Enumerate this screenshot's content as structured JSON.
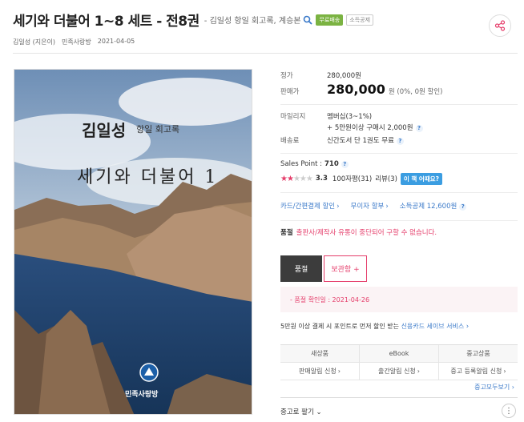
{
  "book": {
    "title": "세기와 더불어 1~8 세트 - 전8권",
    "subtitle": "- 김일성 항일 회고록, 계승본",
    "badge_free_shipping": "무료배송",
    "badge_income_deduction": "소득공제",
    "author": "김일성 (지은이)",
    "publisher": "민족사랑방",
    "pub_date": "2021-04-05"
  },
  "cover": {
    "author_text": "김일성",
    "subtitle_text": "항일 회고록",
    "title_text": "세기와 더불어 1",
    "publisher_logo_text": "민족사랑방"
  },
  "pricing": {
    "list_price_label": "정가",
    "list_price": "280,000원",
    "sale_price_label": "판매가",
    "sale_price": "280,000",
    "sale_price_unit_note": "원 (0%, 0원 할인)",
    "mileage_label": "마일리지",
    "mileage_value": "멤버십(3~1%)",
    "mileage_extra": "+ 5만원이상 구매시 2,000원",
    "shipping_label": "배송료",
    "shipping_value": "신간도서 단 1권도 무료"
  },
  "rating": {
    "sales_point_label": "Sales Point :",
    "sales_point_value": "710",
    "star_score": "3.3",
    "reviews_100": "100자평(31)",
    "reviews": "리뷰(3)",
    "ask_button": "이 책 어때요?"
  },
  "benefits": {
    "card_discount": "카드/간편결제 할인",
    "installment": "무이자 할부",
    "income_deduction": "소득공제 12,600원"
  },
  "status": {
    "soldout_label": "품절",
    "soldout_text": "출판사/제작사 유통이 중단되어 구할 수 없습니다.",
    "btn_soldout": "품절",
    "btn_wishlist": "보관함 +",
    "confirm_text": "- 품절 확인일 : 2021-04-26"
  },
  "promo": {
    "text": "5만원 이상 결제 시 포인트로 먼저 할인 받는",
    "link": "신용카드 세이브 서비스"
  },
  "table": {
    "headers": [
      "새상품",
      "eBook",
      "중고상품"
    ],
    "cells": [
      "판매알림 신청",
      "출간알림 신청",
      "중고 등록알림 신청"
    ]
  },
  "more_used_link": "중고모두보기",
  "used_sort": "중고로 팔기"
}
